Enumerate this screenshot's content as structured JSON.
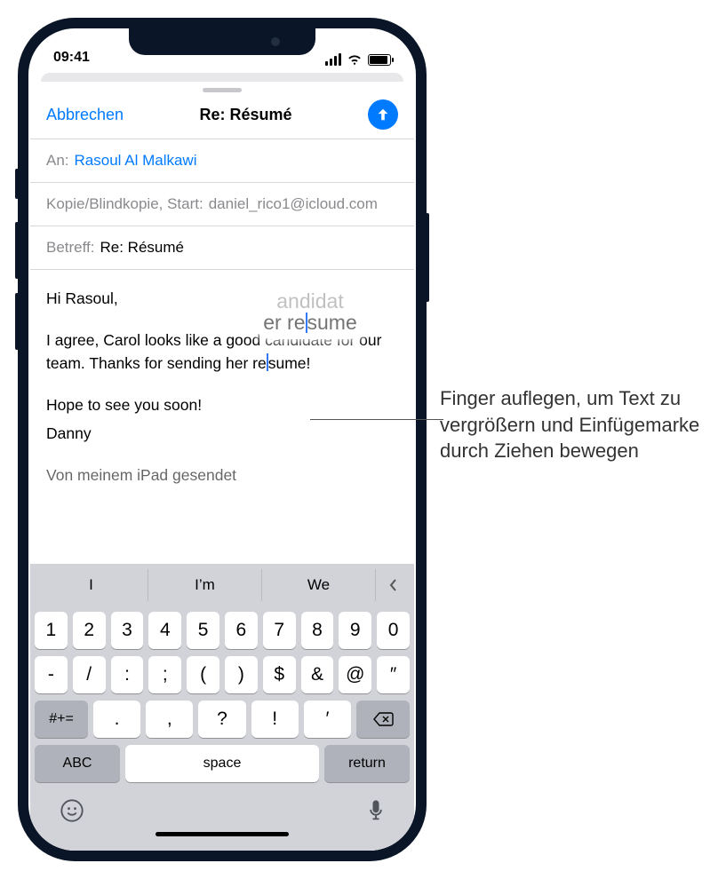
{
  "status": {
    "time": "09:41"
  },
  "nav": {
    "cancel": "Abbrechen",
    "title": "Re: Résumé"
  },
  "fields": {
    "to_label": "An:",
    "to_value": "Rasoul Al Malkawi",
    "cc_label": "Kopie/Blindkopie, Start:",
    "cc_value": "daniel_rico1@icloud.com",
    "subject_label": "Betreff:",
    "subject_value": "Re: Résumé"
  },
  "body": {
    "line1": "Hi Rasoul,",
    "line2a": "I agree, Carol looks like a good candidate for our team. Thanks for sending her re",
    "line2b": "sume!",
    "line3": "Hope to see you soon!",
    "line4": "Danny",
    "line5": "Von meinem iPad gesendet"
  },
  "loupe": {
    "top": "andidat",
    "bot_a": "er re",
    "bot_b": "sume"
  },
  "keyboard": {
    "suggestions": [
      "I",
      "I’m",
      "We"
    ],
    "row1": [
      "1",
      "2",
      "3",
      "4",
      "5",
      "6",
      "7",
      "8",
      "9",
      "0"
    ],
    "row2": [
      "-",
      "/",
      ":",
      ";",
      "(",
      ")",
      "$",
      "&",
      "@",
      "″"
    ],
    "row3_shift": "#+=",
    "row3": [
      ".",
      ",",
      "?",
      "!",
      "′"
    ],
    "abc": "ABC",
    "space": "space",
    "return": "return"
  },
  "callout": "Finger auflegen, um Text zu vergrößern und Einfügemarke durch Ziehen bewegen"
}
